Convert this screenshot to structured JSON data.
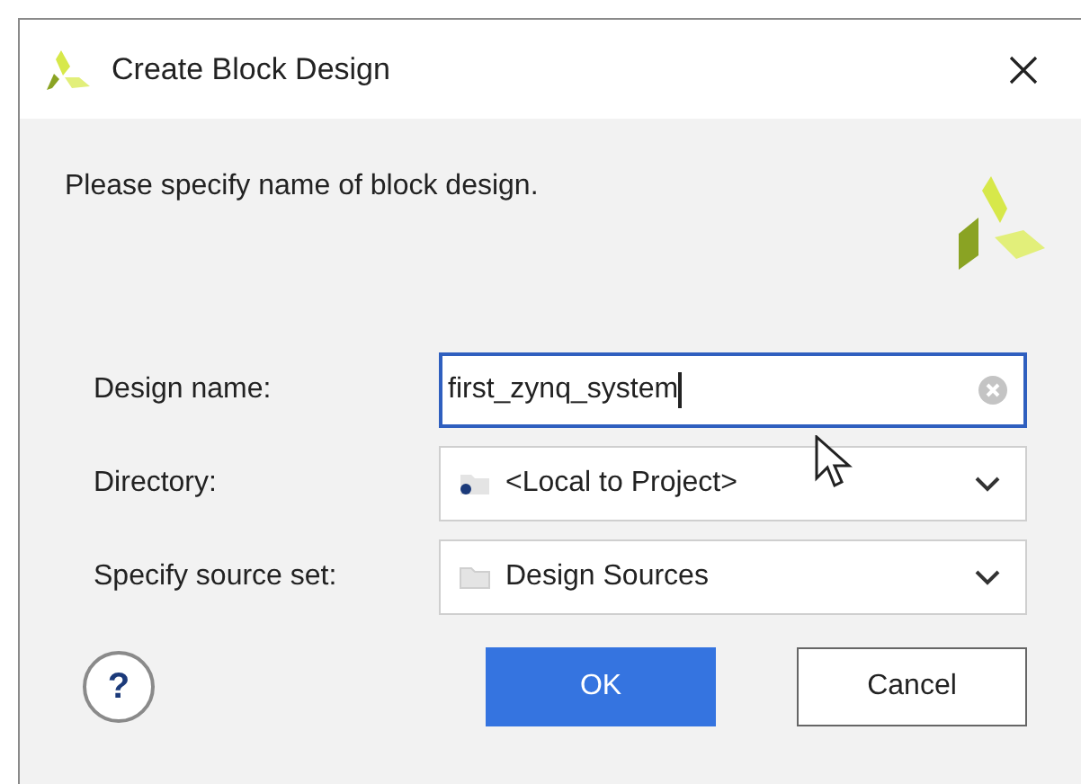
{
  "window": {
    "title": "Create Block Design"
  },
  "prompt": "Please specify name of block design.",
  "fields": [
    {
      "kind": "text",
      "label": "Design name:",
      "value": "first_zynq_system",
      "focused": true
    },
    {
      "kind": "dropdown",
      "label": "Directory:",
      "value": "<Local to Project>"
    },
    {
      "kind": "dropdown",
      "label": "Specify source set:",
      "value": "Design Sources"
    }
  ],
  "help": {
    "label": "?"
  },
  "buttons": [
    {
      "label": "OK",
      "primary": true
    },
    {
      "label": "Cancel",
      "primary": false
    }
  ]
}
